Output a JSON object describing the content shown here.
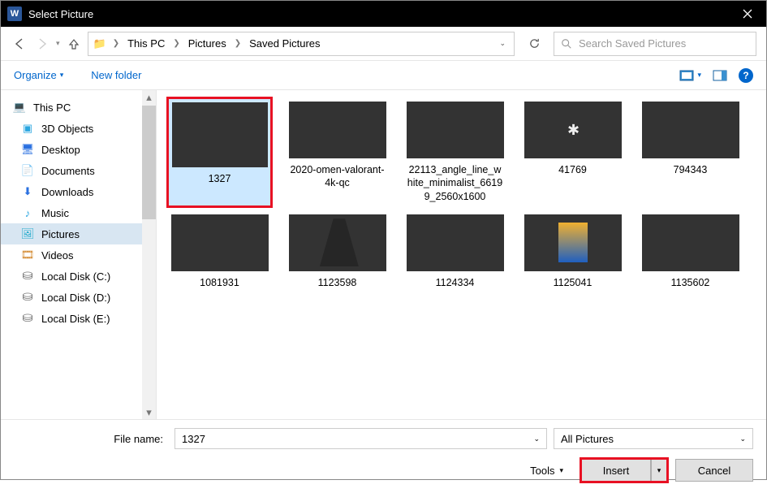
{
  "title": "Select Picture",
  "breadcrumb": {
    "root": "This PC",
    "l1": "Pictures",
    "l2": "Saved Pictures"
  },
  "search": {
    "placeholder": "Search Saved Pictures"
  },
  "toolbar": {
    "organize": "Organize",
    "newfolder": "New folder"
  },
  "sidebar": {
    "root": "This PC",
    "items": [
      "3D Objects",
      "Desktop",
      "Documents",
      "Downloads",
      "Music",
      "Pictures",
      "Videos",
      "Local Disk (C:)",
      "Local Disk (D:)",
      "Local Disk (E:)"
    ]
  },
  "thumbs": [
    {
      "name": "1327",
      "cls": "img-1327",
      "sel": true,
      "hl": true
    },
    {
      "name": "2020-omen-valorant-4k-qc",
      "cls": "img-omen"
    },
    {
      "name": "22113_angle_line_white_minimalist_66199_2560x1600",
      "cls": "img-angle"
    },
    {
      "name": "41769",
      "cls": "img-41769"
    },
    {
      "name": "794343",
      "cls": "img-794343"
    },
    {
      "name": "1081931",
      "cls": "img-1081931"
    },
    {
      "name": "1123598",
      "cls": "img-1123598"
    },
    {
      "name": "1124334",
      "cls": "img-1124334"
    },
    {
      "name": "1125041",
      "cls": "img-1125041"
    },
    {
      "name": "1135602",
      "cls": "img-1135602"
    }
  ],
  "footer": {
    "fnlabel": "File name:",
    "fnvalue": "1327",
    "filter": "All Pictures",
    "tools": "Tools",
    "insert": "Insert",
    "cancel": "Cancel"
  }
}
